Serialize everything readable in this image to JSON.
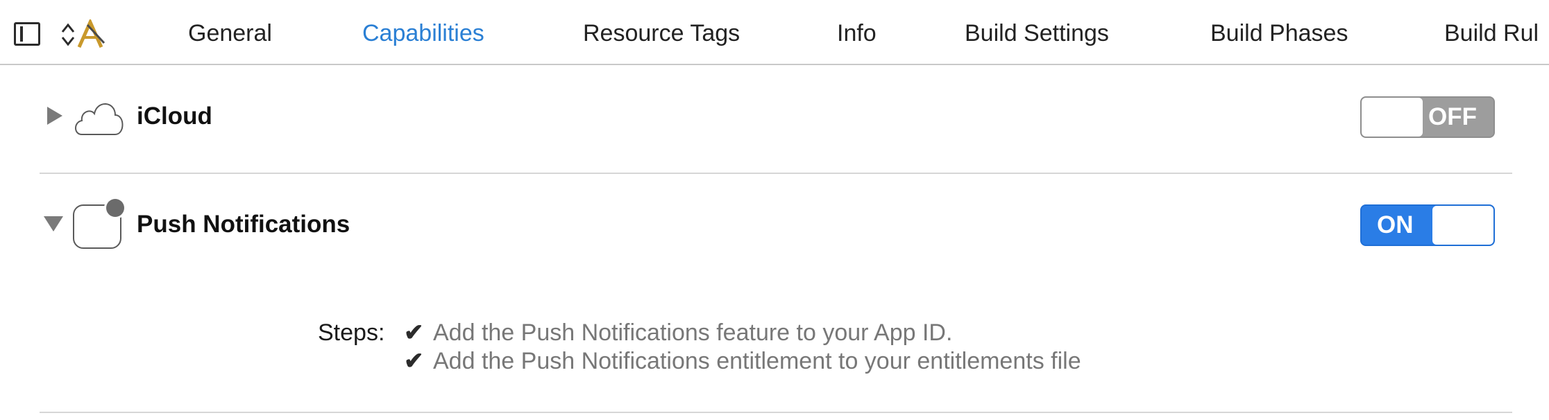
{
  "toolbar": {
    "icons": [
      "sidebar-toggle-icon",
      "target-picker-icon"
    ],
    "tabs": [
      {
        "label": "General",
        "active": false
      },
      {
        "label": "Capabilities",
        "active": true
      },
      {
        "label": "Resource Tags",
        "active": false
      },
      {
        "label": "Info",
        "active": false
      },
      {
        "label": "Build Settings",
        "active": false
      },
      {
        "label": "Build Phases",
        "active": false
      },
      {
        "label": "Build Rul",
        "active": false
      }
    ],
    "accent_color": "#2a7fd4"
  },
  "capabilities": [
    {
      "title": "iCloud",
      "icon": "cloud-icon",
      "expanded": false,
      "switch": {
        "label": "OFF",
        "state": "off"
      }
    },
    {
      "title": "Push Notifications",
      "icon": "push-notification-icon",
      "expanded": true,
      "switch": {
        "label": "ON",
        "state": "on"
      },
      "steps_label": "Steps:",
      "steps": [
        {
          "check": "✔",
          "text": "Add the Push Notifications feature to your App ID."
        },
        {
          "check": "✔",
          "text": "Add the Push Notifications entitlement to your entitlements file"
        }
      ]
    }
  ],
  "colors": {
    "switch_on": "#2a7de6",
    "switch_off": "#9d9d9d"
  }
}
